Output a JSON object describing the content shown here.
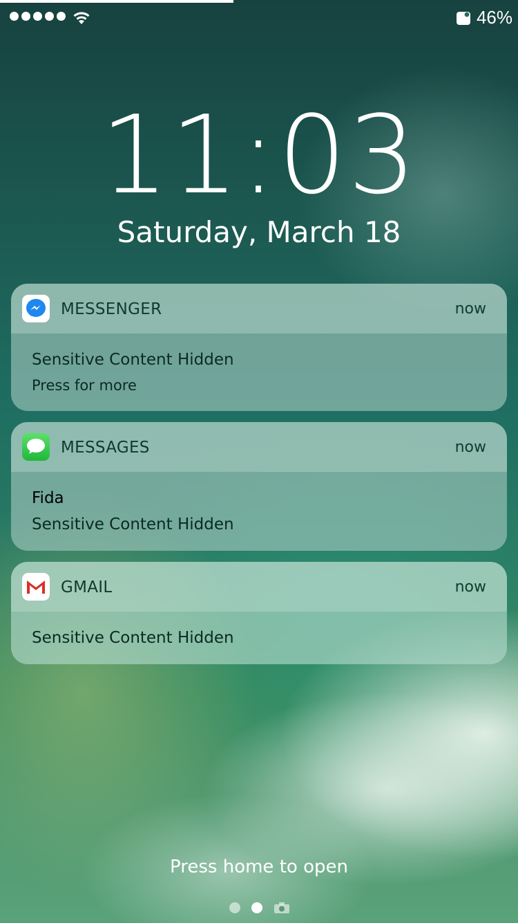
{
  "status_bar": {
    "signal_dots": 5,
    "battery_percent": "46%"
  },
  "lock_screen": {
    "time": "11:03",
    "date": "Saturday, March 18",
    "hint": "Press home to open"
  },
  "notifications": [
    {
      "app": "MESSENGER",
      "time": "now",
      "icon": "messenger-icon",
      "line1": "Sensitive Content Hidden",
      "line2": "Press for more"
    },
    {
      "app": "MESSAGES",
      "time": "now",
      "icon": "messages-icon",
      "sender": "Fida",
      "line1": "Sensitive Content Hidden"
    },
    {
      "app": "GMAIL",
      "time": "now",
      "icon": "gmail-icon",
      "line1": "Sensitive Content Hidden"
    }
  ],
  "colors": {
    "messenger_blue": "#1e87f0",
    "messages_green": "#34c84a",
    "gmail_red": "#d93025"
  }
}
